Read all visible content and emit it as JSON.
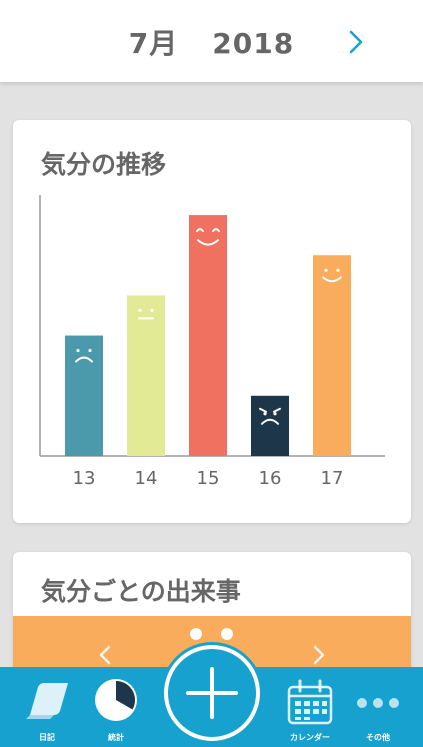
{
  "header": {
    "month": "7月",
    "year": "2018"
  },
  "colors": {
    "accent": "#16a1cf",
    "axis": "#999999",
    "bar_13": "#4b9aab",
    "bar_14": "#e3ea96",
    "bar_15": "#f07160",
    "bar_16": "#1e3649",
    "bar_17": "#f9ad5c"
  },
  "mood_chart": {
    "title": "気分の推移"
  },
  "chart_data": {
    "type": "bar",
    "title": "気分の推移",
    "categories": [
      "13",
      "14",
      "15",
      "16",
      "17"
    ],
    "values": [
      3,
      4,
      6,
      1.5,
      5
    ],
    "moods": [
      "sad",
      "neutral",
      "very-happy",
      "very-sad",
      "happy"
    ],
    "ylim": [
      0,
      6.5
    ],
    "grid": false
  },
  "events_card": {
    "title": "気分ごとの出来事"
  },
  "bottom_nav": {
    "diary": "日記",
    "stats": "統計",
    "calendar": "カレンダー",
    "more": "その他"
  },
  "icons": {
    "next": "chevron-right-icon",
    "prev_strip": "chevron-left-icon",
    "next_strip": "chevron-right-icon",
    "diary": "notebook-icon",
    "stats": "pie-chart-icon",
    "add": "plus-icon",
    "calendar": "calendar-icon",
    "more": "more-dots-icon"
  }
}
